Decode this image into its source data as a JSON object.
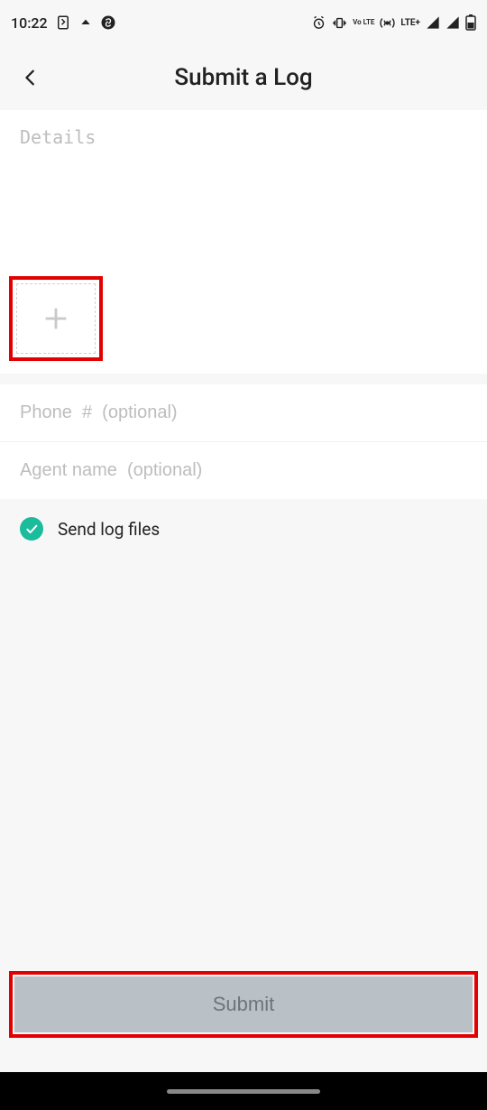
{
  "status": {
    "time": "10:22",
    "network_label": "LTE+",
    "volte_label": "Vo LTE"
  },
  "header": {
    "title": "Submit a Log"
  },
  "form": {
    "details_placeholder": "Details",
    "details_value": "",
    "phone_placeholder": "Phone  #  (optional)",
    "phone_value": "",
    "agent_placeholder": "Agent name  (optional)",
    "agent_value": "",
    "send_logs_label": "Send log files",
    "send_logs_checked": true,
    "submit_label": "Submit"
  },
  "colors": {
    "highlight": "#e30000",
    "accent": "#1abc9c",
    "submit_bg": "#b9c1c7",
    "submit_fg": "#6d757a"
  }
}
